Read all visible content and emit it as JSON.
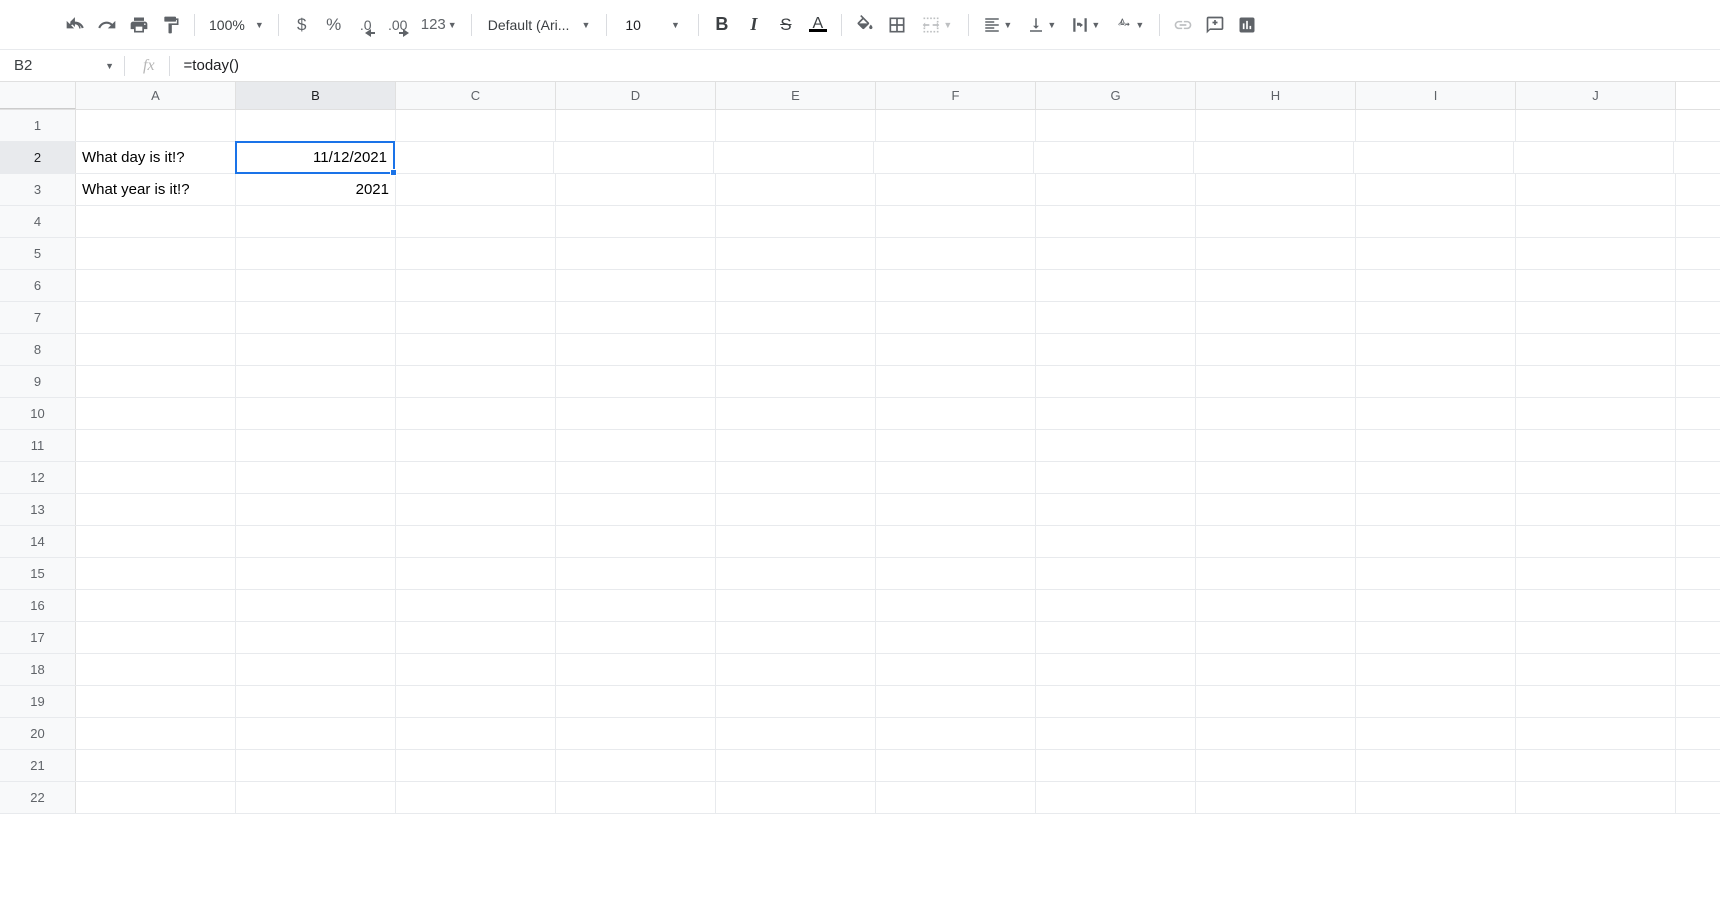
{
  "toolbar": {
    "zoom": "100%",
    "currency": "$",
    "percent": "%",
    "dec_dec": ".0",
    "inc_dec": ".00",
    "num_format": "123",
    "font_name": "Default (Ari...",
    "font_size": "10",
    "bold": "B",
    "italic": "I",
    "strike": "S",
    "textcolor": "A"
  },
  "formula_bar": {
    "cell_ref": "B2",
    "fx": "fx",
    "formula": "=today()"
  },
  "columns": [
    "A",
    "B",
    "C",
    "D",
    "E",
    "F",
    "G",
    "H",
    "I",
    "J"
  ],
  "rows": [
    1,
    2,
    3,
    4,
    5,
    6,
    7,
    8,
    9,
    10,
    11,
    12,
    13,
    14,
    15,
    16,
    17,
    18,
    19,
    20,
    21,
    22
  ],
  "cells": {
    "A2": "What day is it!?",
    "B2": "11/12/2021",
    "A3": "What year is it!?",
    "B3": "2021"
  },
  "selected": {
    "col": "B",
    "row": 2
  }
}
